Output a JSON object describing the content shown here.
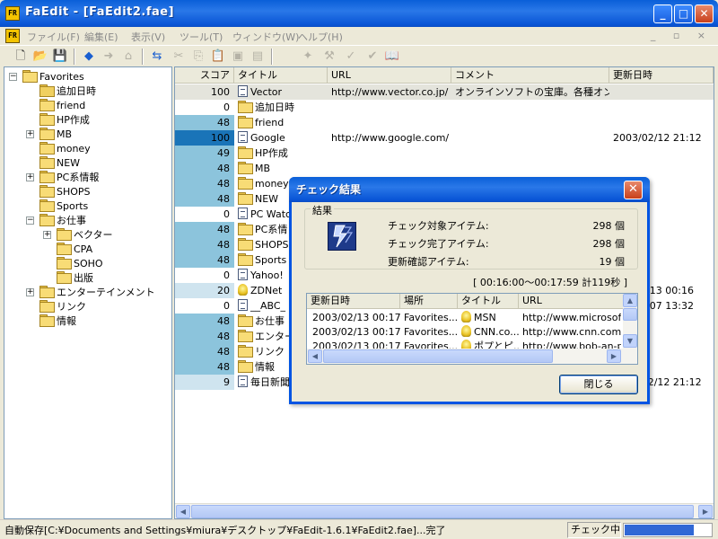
{
  "window": {
    "title": "FaEdit - [FaEdit2.fae]",
    "app_icon_text": "FR",
    "minimize": "_",
    "maximize": "□",
    "close": "✕"
  },
  "menu": {
    "items": [
      "ファイル(F)",
      "編集(E)",
      "表示(V)",
      "ツール(T)",
      "ウィンドウ(W)",
      "ヘルプ(H)"
    ],
    "mdi_controls": "_ ▫ ×"
  },
  "toolbar": {
    "icons": [
      "new-file-icon",
      "open-folder-icon",
      "save-icon",
      "back-arrow-icon",
      "forward-arrow-icon",
      "home-icon",
      "link-check-icon",
      "cut-icon",
      "copy-icon",
      "paste-icon",
      "properties-icon",
      "view-icon",
      "globe-icon",
      "tools-icon",
      "check-icon",
      "check2-icon",
      "reader-icon"
    ]
  },
  "tree": {
    "nodes": [
      {
        "label": "Favorites",
        "level": 0,
        "expander": "−"
      },
      {
        "label": "追加日時",
        "level": 1,
        "expander": ""
      },
      {
        "label": "friend",
        "level": 1,
        "expander": ""
      },
      {
        "label": "HP作成",
        "level": 1,
        "expander": ""
      },
      {
        "label": "MB",
        "level": 1,
        "expander": "+"
      },
      {
        "label": "money",
        "level": 1,
        "expander": ""
      },
      {
        "label": "NEW",
        "level": 1,
        "expander": ""
      },
      {
        "label": "PC系情報",
        "level": 1,
        "expander": "+"
      },
      {
        "label": "SHOPS",
        "level": 1,
        "expander": ""
      },
      {
        "label": "Sports",
        "level": 1,
        "expander": ""
      },
      {
        "label": "お仕事",
        "level": 1,
        "expander": "−"
      },
      {
        "label": "ベクター",
        "level": 2,
        "expander": "+"
      },
      {
        "label": "CPA",
        "level": 2,
        "expander": ""
      },
      {
        "label": "SOHO",
        "level": 2,
        "expander": ""
      },
      {
        "label": "出版",
        "level": 2,
        "expander": ""
      },
      {
        "label": "エンターテインメント",
        "level": 1,
        "expander": "+"
      },
      {
        "label": "リンク",
        "level": 1,
        "expander": ""
      },
      {
        "label": "情報",
        "level": 1,
        "expander": ""
      }
    ]
  },
  "list": {
    "headers": [
      "スコア",
      "タイトル",
      "URL",
      "コメント",
      "更新日時"
    ],
    "rows": [
      {
        "score": "100",
        "score_pct": 0,
        "type": "page",
        "title": "Vector",
        "url": "http://www.vector.co.jp/",
        "comment": "オンラインソフトの宝庫。各種オン...",
        "date": "",
        "selected": true
      },
      {
        "score": "0",
        "score_pct": 0,
        "type": "special",
        "title": "追加日時",
        "url": "",
        "comment": "",
        "date": ""
      },
      {
        "score": "48",
        "score_pct": 48,
        "type": "folder",
        "title": "friend",
        "url": "",
        "comment": "",
        "date": ""
      },
      {
        "score": "100",
        "score_pct": 100,
        "type": "page",
        "title": "Google",
        "url": "http://www.google.com/",
        "comment": "",
        "date": "2003/02/12 21:12"
      },
      {
        "score": "49",
        "score_pct": 49,
        "type": "folder",
        "title": "HP作成",
        "url": "",
        "comment": "",
        "date": ""
      },
      {
        "score": "48",
        "score_pct": 48,
        "type": "folder",
        "title": "MB",
        "url": "",
        "comment": "",
        "date": ""
      },
      {
        "score": "48",
        "score_pct": 48,
        "type": "folder",
        "title": "money",
        "url": "",
        "comment": "",
        "date": ""
      },
      {
        "score": "48",
        "score_pct": 48,
        "type": "folder",
        "title": "NEW",
        "url": "",
        "comment": "",
        "date": ""
      },
      {
        "score": "0",
        "score_pct": 0,
        "type": "page",
        "title": "PC Watc",
        "url": "",
        "comment": "",
        "date": ""
      },
      {
        "score": "48",
        "score_pct": 48,
        "type": "folder",
        "title": "PC系情",
        "url": "",
        "comment": "",
        "date": ""
      },
      {
        "score": "48",
        "score_pct": 48,
        "type": "folder",
        "title": "SHOPS",
        "url": "",
        "comment": "",
        "date": ""
      },
      {
        "score": "48",
        "score_pct": 48,
        "type": "folder",
        "title": "Sports",
        "url": "",
        "comment": "",
        "date": ""
      },
      {
        "score": "0",
        "score_pct": 0,
        "type": "page",
        "title": "Yahoo!",
        "url": "",
        "comment": "",
        "date": ""
      },
      {
        "score": "20",
        "score_pct": 20,
        "type": "bulb",
        "title": "ZDNet",
        "url": "",
        "comment": "",
        "date": "2/13 00:16"
      },
      {
        "score": "0",
        "score_pct": 0,
        "type": "page",
        "title": "__ABC_",
        "url": "",
        "comment": "",
        "date": "/07 13:32"
      },
      {
        "score": "48",
        "score_pct": 48,
        "type": "folder",
        "title": "お仕事",
        "url": "",
        "comment": "",
        "date": ""
      },
      {
        "score": "48",
        "score_pct": 48,
        "type": "folder",
        "title": "エンター",
        "url": "",
        "comment": "",
        "date": ""
      },
      {
        "score": "48",
        "score_pct": 48,
        "type": "folder",
        "title": "リンク",
        "url": "",
        "comment": "",
        "date": ""
      },
      {
        "score": "48",
        "score_pct": 48,
        "type": "folder",
        "title": "情報",
        "url": "",
        "comment": "",
        "date": ""
      },
      {
        "score": "9",
        "score_pct": 9,
        "type": "page",
        "title": "毎日新聞",
        "url": "",
        "comment": "",
        "date": "2003/02/12 21:12"
      }
    ]
  },
  "status": {
    "text": "自動保存[C:¥Documents and Settings¥miura¥デスクトップ¥FaEdit-1.6.1¥FaEdit2.fae]...完了",
    "state": "チェック中",
    "progress": 0.8
  },
  "dialog": {
    "title": "チェック結果",
    "group_label": "結果",
    "stats": [
      {
        "label": "チェック対象アイテム:",
        "value": "298 個"
      },
      {
        "label": "チェック完了アイテム:",
        "value": "298 個"
      },
      {
        "label": "更新確認アイテム:",
        "value": "19 個"
      }
    ],
    "duration": "[ 00:16:00〜00:17:59  計119秒 ]",
    "list_headers": [
      "更新日時",
      "場所",
      "タイトル",
      "URL"
    ],
    "list_rows": [
      {
        "date": "2003/02/13 00:17",
        "place": "Favorites...",
        "title": "MSN",
        "url": "http://www.microsoft..."
      },
      {
        "date": "2003/02/13 00:17",
        "place": "Favorites...",
        "title": "CNN.co...",
        "url": "http://www.cnn.com/"
      },
      {
        "date": "2003/02/13 00:17",
        "place": "Favorites...",
        "title": "ポプとピ...",
        "url": "http://www.bob-an-p..."
      }
    ],
    "close_button": "閉じる"
  },
  "colors": {
    "score_bar": "#8cc4dc",
    "score_bar_full": "#1a74b8",
    "titlebar": "#0a5fd8",
    "progress": "#3168d5"
  }
}
